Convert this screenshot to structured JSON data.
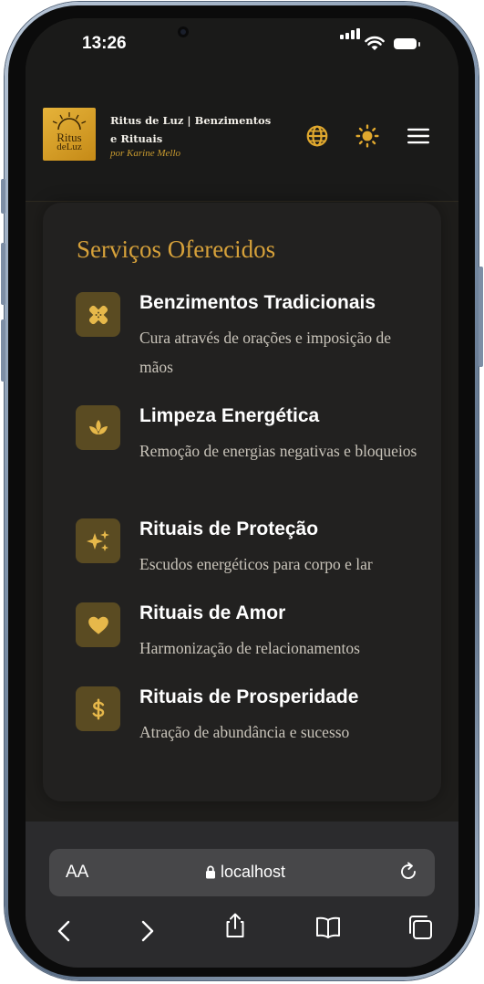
{
  "status_bar": {
    "time": "13:26"
  },
  "header": {
    "logo_line1": "Ritus",
    "logo_line2": "deLuz",
    "title": "Ritus de Luz | Benzimentos e Rituais",
    "subtitle": "por Karine Mello",
    "icons": [
      "globe-icon",
      "sun-icon",
      "menu-icon"
    ]
  },
  "services_section": {
    "title": "Serviços Oferecidos",
    "items": [
      {
        "name": "Benzimentos Tradicionais",
        "description": "Cura através de orações e imposição de mãos",
        "icon": "bandage-icon"
      },
      {
        "name": "Limpeza Energética",
        "description": "Remoção de energias negativas e bloqueios",
        "icon": "lotus-icon"
      },
      {
        "name": "Rituais de Proteção",
        "description": "Escudos energéticos para corpo e lar",
        "icon": "sparkles-icon"
      },
      {
        "name": "Rituais de Amor",
        "description": "Harmonização de relacionamentos",
        "icon": "heart-icon"
      },
      {
        "name": "Rituais de Prosperidade",
        "description": "Atração de abundância e sucesso",
        "icon": "dollar-icon"
      }
    ]
  },
  "browser": {
    "aa_label": "AA",
    "url": "localhost",
    "nav": [
      "back-icon",
      "forward-icon",
      "share-icon",
      "bookmarks-icon",
      "tabs-icon"
    ]
  },
  "colors": {
    "accent": "#d6a13a",
    "background": "#1e1d1b",
    "card": "#222120",
    "icon_tile": "#5a4b22"
  }
}
